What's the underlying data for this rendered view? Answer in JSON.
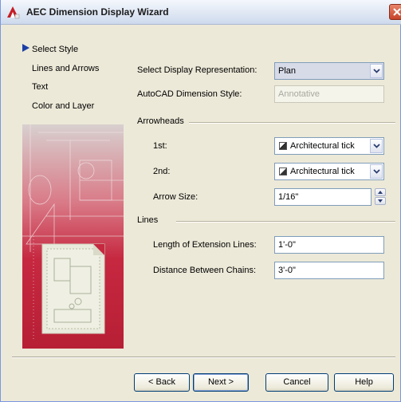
{
  "window": {
    "title": "AEC Dimension Display Wizard"
  },
  "nav": {
    "items": [
      {
        "label": "Select Style"
      },
      {
        "label": "Lines and Arrows"
      },
      {
        "label": "Text"
      },
      {
        "label": "Color and Layer"
      }
    ],
    "current_index": 1
  },
  "form": {
    "display_rep": {
      "label": "Select Display Representation:",
      "value": "Plan"
    },
    "dim_style": {
      "label": "AutoCAD Dimension Style:",
      "value": "Annotative"
    },
    "arrowheads": {
      "heading": "Arrowheads",
      "first": {
        "label": "1st:",
        "value": "Architectural tick"
      },
      "second": {
        "label": "2nd:",
        "value": "Architectural tick"
      },
      "size": {
        "label": "Arrow Size:",
        "value": "1/16\""
      }
    },
    "lines": {
      "heading": "Lines",
      "ext_length": {
        "label": "Length of Extension Lines:",
        "value": "1'-0\""
      },
      "chain_distance": {
        "label": "Distance Between Chains:",
        "value": "3'-0\""
      }
    }
  },
  "buttons": {
    "back": "< Back",
    "next": "Next >",
    "cancel": "Cancel",
    "help": "Help"
  },
  "colors": {
    "accent": "#1c3fa6",
    "illustration": "#c62840",
    "dialog_bg": "#ece9d8"
  }
}
